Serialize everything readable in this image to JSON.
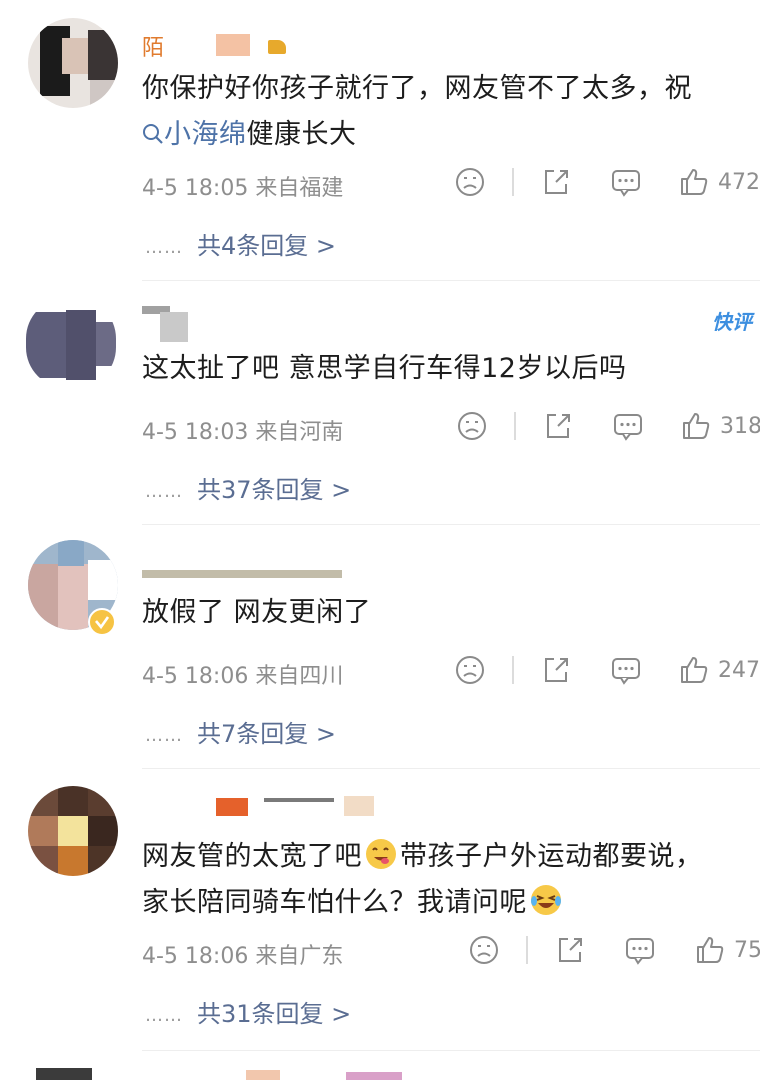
{
  "comments": [
    {
      "username": "陌",
      "text_plain": "你保护好你孩子就行了，网友管不了太多，祝",
      "hashtag": "小海绵",
      "text_after_hashtag": "健康长大",
      "time": "4-5 18:05",
      "location": "来自福建",
      "likes": "472",
      "replies": "共4条回复 >"
    },
    {
      "username": "",
      "badge": "快评",
      "text": "这太扯了吧  意思学自行车得12岁以后吗",
      "time": "4-5 18:03",
      "location": "来自河南",
      "likes": "318",
      "replies": "共37条回复 >"
    },
    {
      "username": "",
      "text": "放假了 网友更闲了",
      "time": "4-5 18:06",
      "location": "来自四川",
      "likes": "247",
      "replies": "共7条回复 >"
    },
    {
      "username": "",
      "text_part1": "网友管的太宽了吧",
      "text_part2": "带孩子户外运动都要说，",
      "text_line2": "家长陪同骑车怕什么？我请问呢",
      "time": "4-5 18:06",
      "location": "来自广东",
      "likes": "75",
      "replies": "共31条回复 >"
    }
  ],
  "ui": {
    "reply_dots": "……",
    "icons": [
      "search-icon",
      "dislike-icon",
      "share-icon",
      "comment-icon",
      "like-icon",
      "verified-icon"
    ],
    "colors": {
      "link": "#5a6d92",
      "hashtag": "#4e73a8",
      "meta": "#8e8e8e",
      "badge": "#3d8fe0",
      "verified": "#f6c343"
    }
  }
}
